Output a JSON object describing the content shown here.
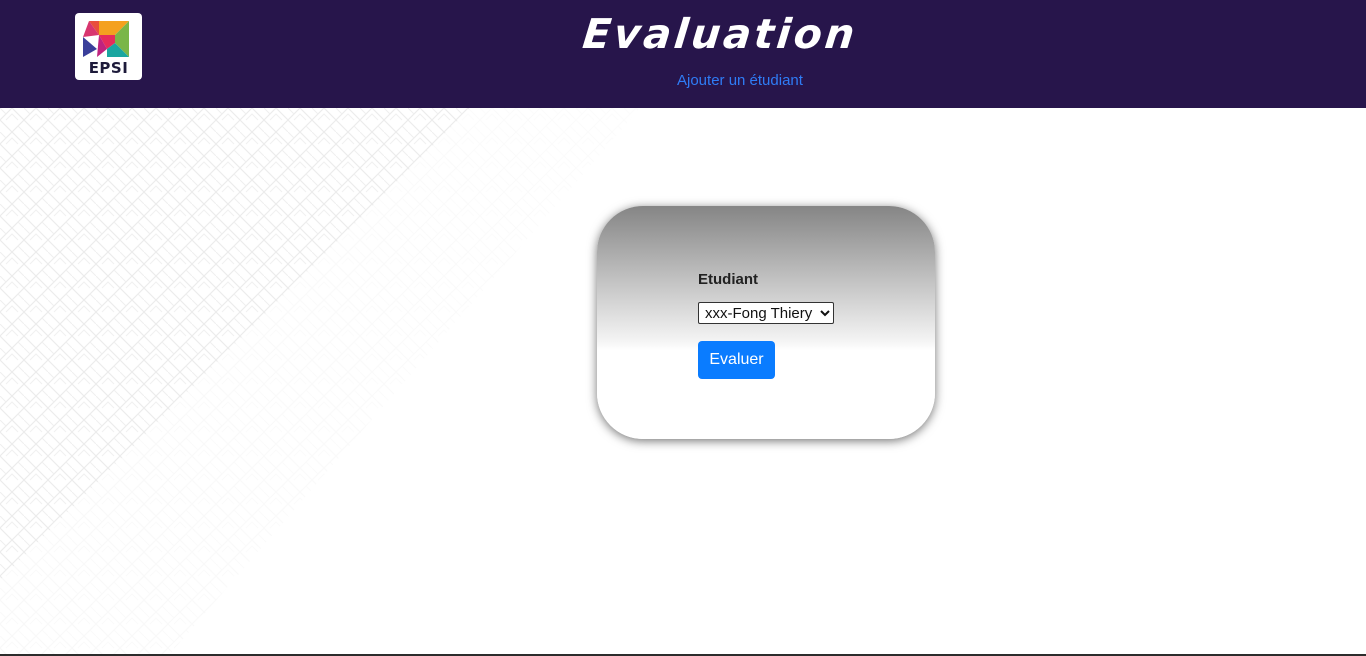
{
  "header": {
    "logo_text": "EPSI",
    "title": "Evaluation",
    "nav_link": "Ajouter un étudiant"
  },
  "form": {
    "label": "Etudiant",
    "selected_student": "xxx-Fong Thiery",
    "submit_label": "Evaluer"
  },
  "colors": {
    "header_bg": "#27154b",
    "link": "#2f7cf6",
    "button": "#0a7cff"
  }
}
